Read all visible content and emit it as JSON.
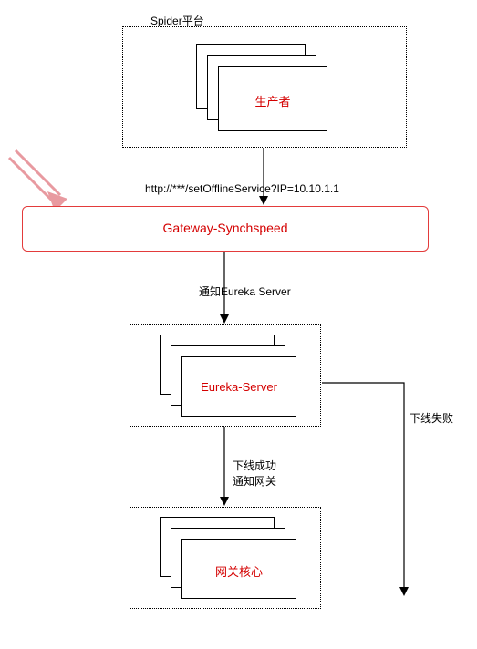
{
  "spider": {
    "title": "Spider平台",
    "producer": "生产者"
  },
  "http_call": "http://***/setOfflineService?IP=10.10.1.1",
  "gateway": {
    "name": "Gateway-Synchspeed"
  },
  "notify_eureka": "通知Eureka Server",
  "eureka": {
    "name": "Eureka-Server"
  },
  "offline_fail": "下线失败",
  "offline_success_line1": "下线成功",
  "offline_success_line2": "通知网关",
  "gateway_core": {
    "name": "网关核心"
  }
}
